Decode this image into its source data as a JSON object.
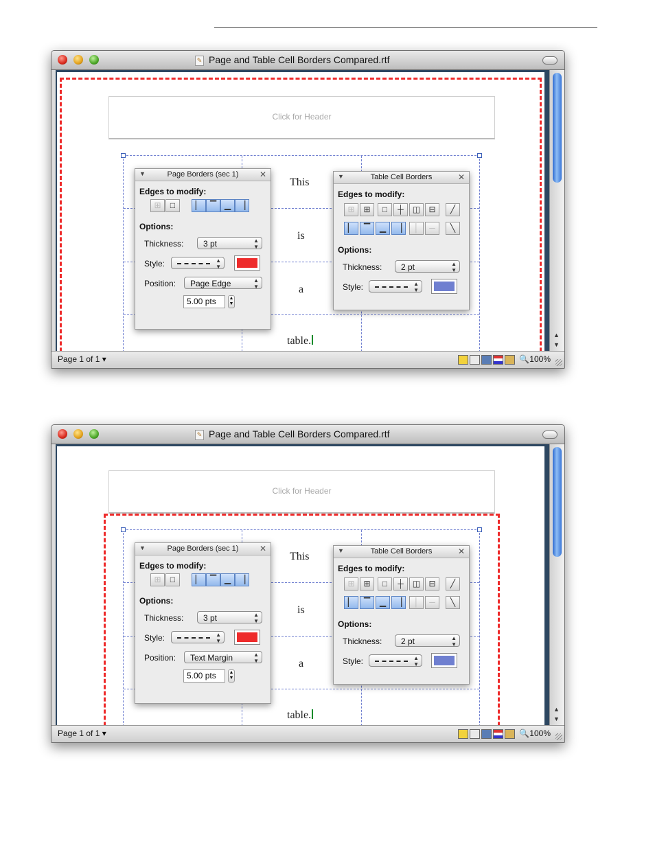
{
  "windows": [
    {
      "title": "Page and Table Cell Borders Compared.rtf",
      "header_placeholder": "Click for Header",
      "status_page": "Page 1 of 1",
      "zoom": "100%",
      "table_words": [
        "This",
        "is",
        "a",
        "table."
      ],
      "page_borders_panel": {
        "title": "Page Borders (sec 1)",
        "edges_label": "Edges to modify:",
        "options_label": "Options:",
        "thickness_label": "Thickness:",
        "thickness_value": "3 pt",
        "style_label": "Style:",
        "position_label": "Position:",
        "position_value": "Page Edge",
        "offset_value": "5.00 pts",
        "color": "#ee2b2b"
      },
      "table_cell_panel": {
        "title": "Table Cell Borders",
        "edges_label": "Edges to modify:",
        "options_label": "Options:",
        "thickness_label": "Thickness:",
        "thickness_value": "2 pt",
        "style_label": "Style:",
        "color": "#6f7fd0"
      }
    },
    {
      "title": "Page and Table Cell Borders Compared.rtf",
      "header_placeholder": "Click for Header",
      "status_page": "Page 1 of 1",
      "zoom": "100%",
      "table_words": [
        "This",
        "is",
        "a",
        "table."
      ],
      "page_borders_panel": {
        "title": "Page Borders (sec 1)",
        "edges_label": "Edges to modify:",
        "options_label": "Options:",
        "thickness_label": "Thickness:",
        "thickness_value": "3 pt",
        "style_label": "Style:",
        "position_label": "Position:",
        "position_value": "Text Margin",
        "offset_value": "5.00 pts",
        "color": "#ee2b2b"
      },
      "table_cell_panel": {
        "title": "Table Cell Borders",
        "edges_label": "Edges to modify:",
        "options_label": "Options:",
        "thickness_label": "Thickness:",
        "thickness_value": "2 pt",
        "style_label": "Style:",
        "color": "#6f7fd0"
      }
    }
  ],
  "icons": {
    "close": "close-icon",
    "minimize": "minimize-icon",
    "zoom": "zoom-icon",
    "disclosure": "disclosure-triangle-icon",
    "panel_close": "panel-close-icon",
    "magnifier": "magnifier-icon",
    "document": "document-icon"
  }
}
